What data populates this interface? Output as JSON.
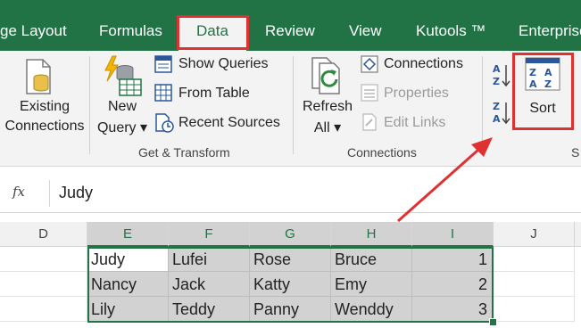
{
  "tabs": {
    "page_layout": "ge Layout",
    "formulas": "Formulas",
    "data": "Data",
    "review": "Review",
    "view": "View",
    "kutools": "Kutools ™",
    "enterprise": "Enterprise"
  },
  "ribbon": {
    "existing_connections": [
      "Existing",
      "Connections"
    ],
    "new_query": [
      "New",
      "Query ▾"
    ],
    "show_queries": "Show Queries",
    "from_table": "From Table",
    "recent_sources": "Recent Sources",
    "get_transform": "Get & Transform",
    "refresh_all": [
      "Refresh",
      "All ▾"
    ],
    "connections": "Connections",
    "properties": "Properties",
    "edit_links": "Edit Links",
    "connections_group": "Connections",
    "sort": "Sort",
    "sort_group_partial": "S"
  },
  "formula_bar": {
    "fx": "fx",
    "value": "Judy"
  },
  "columns": [
    "D",
    "E",
    "F",
    "G",
    "H",
    "I",
    "J"
  ],
  "rows": [
    [
      "Judy",
      "Lufei",
      "Rose",
      "Bruce",
      "1"
    ],
    [
      "Nancy",
      "Jack",
      "Katty",
      "Emy",
      "2"
    ],
    [
      "Lily",
      "Teddy",
      "Panny",
      "Wenddy",
      "3"
    ]
  ],
  "colors": {
    "ribbon_tab_bg": "#217346",
    "highlight": "#e03131",
    "selection": "#217346"
  }
}
